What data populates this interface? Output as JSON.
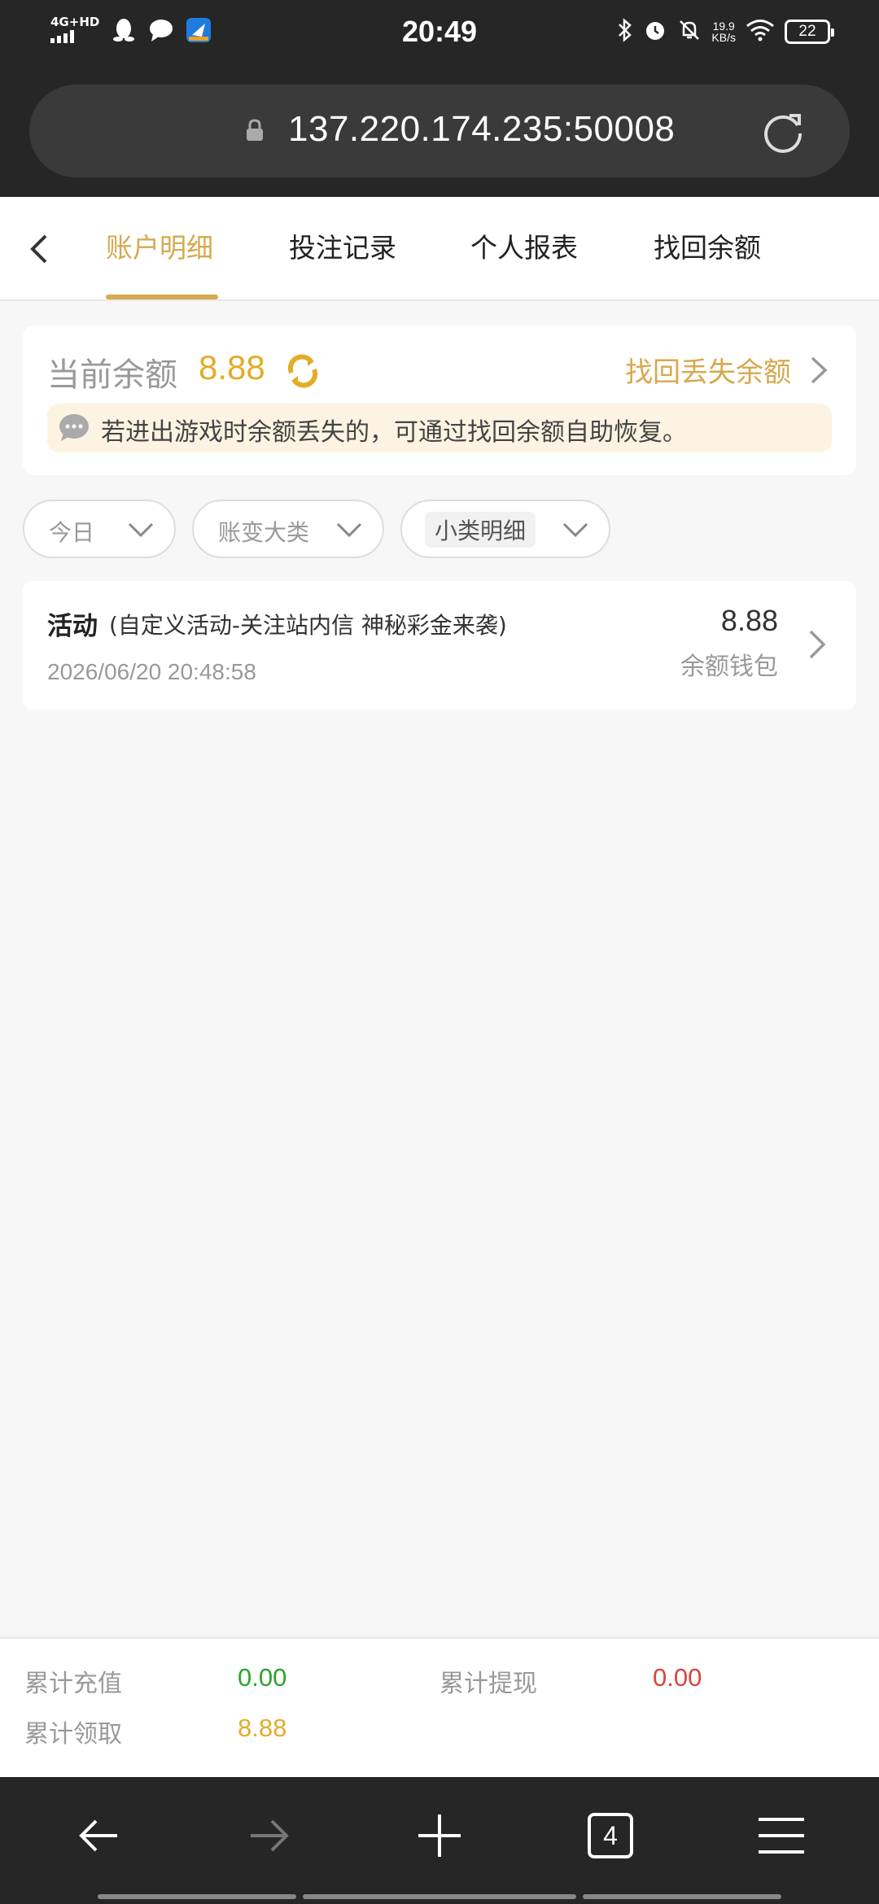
{
  "status_bar": {
    "network": "4G+HD",
    "time": "20:49",
    "speed_value": "19.9",
    "speed_unit": "KB/s",
    "battery": "22"
  },
  "browser": {
    "url": "137.220.174.235:50008"
  },
  "tabs": [
    {
      "label": "账户明细",
      "active": true
    },
    {
      "label": "投注记录",
      "active": false
    },
    {
      "label": "个人报表",
      "active": false
    },
    {
      "label": "找回余额",
      "active": false
    }
  ],
  "balance": {
    "label": "当前余额",
    "value": "8.88",
    "recover_link": "找回丢失余额",
    "notice": "若进出游戏时余额丢失的，可通过找回余额自助恢复。"
  },
  "filters": [
    {
      "label": "今日"
    },
    {
      "label": "账变大类"
    },
    {
      "label": "小类明细"
    }
  ],
  "records": [
    {
      "type": "活动",
      "detail": "(自定义活动-关注站内信 神秘彩金来袭)",
      "time": "2026/06/20 20:48:58",
      "amount": "8.88",
      "wallet": "余额钱包"
    }
  ],
  "totals": {
    "recharge_label": "累计充值",
    "recharge_value": "0.00",
    "withdraw_label": "累计提现",
    "withdraw_value": "0.00",
    "claim_label": "累计领取",
    "claim_value": "8.88"
  },
  "colors": {
    "accent": "#d6a94e",
    "balance": "#e2ac27",
    "green": "#2aa52a",
    "red": "#d9453b"
  },
  "browser_nav": {
    "tab_count": "4",
    "icons": [
      "back-icon",
      "forward-icon",
      "new-tab-icon",
      "tabs-icon",
      "menu-icon"
    ]
  }
}
